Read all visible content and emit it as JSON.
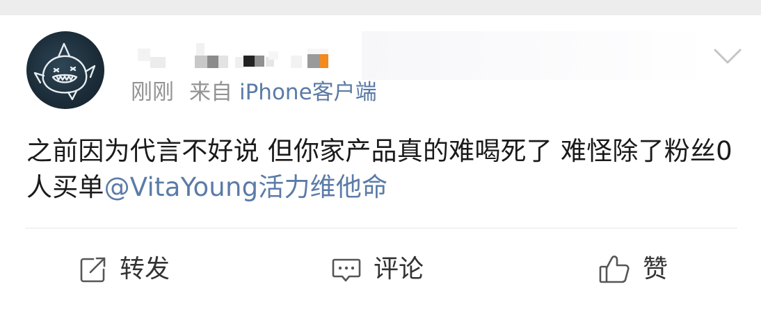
{
  "post": {
    "time": "刚刚",
    "source_label": "来自",
    "source": "iPhone客户端",
    "text_main": "之前因为代言不好说 但你家产品真的难喝死了 难怪除了粉丝0人买单",
    "mention": "@VitaYoung活力维他命"
  },
  "actions": {
    "repost": "转发",
    "comment": "评论",
    "like": "赞"
  },
  "colors": {
    "link": "#5b7ba8",
    "meta": "#939393",
    "text": "#1a1a1a",
    "orange_pixel": "#f28a1e"
  },
  "icons": {
    "chevron": "chevron-down-icon",
    "repost": "repost-icon",
    "comment": "comment-icon",
    "like": "thumbs-up-icon"
  }
}
